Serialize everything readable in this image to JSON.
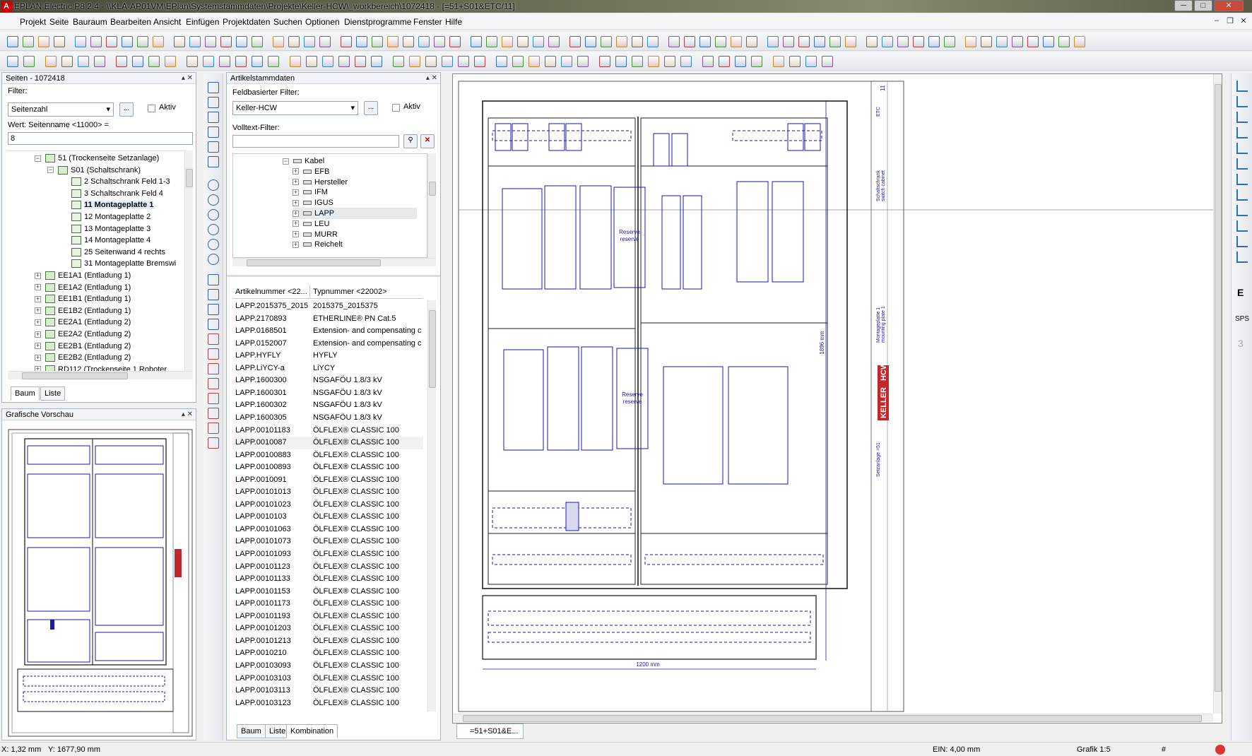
{
  "window": {
    "title": "EPLAN Electric P8 2.4 - \\\\KLA-AP01VM\\EPlan\\Systemstammdaten\\Projekte\\Keller-HCW\\_workbereich\\1072418 - [=51+S01&ETC/11]",
    "logo_text": "A",
    "minimize": "─",
    "maximize": "□",
    "close": "✕"
  },
  "menu": {
    "items": [
      "Projekt",
      "Seite",
      "Bauraum",
      "Bearbeiten",
      "Ansicht",
      "Einfügen",
      "Projektdaten",
      "Suchen",
      "Optionen",
      "Dienstprogramme",
      "Fenster",
      "Hilfe"
    ],
    "mdi_min": "–",
    "mdi_restore": "❐",
    "mdi_close": "✕"
  },
  "pages_panel": {
    "title": "Seiten - 1072418",
    "filter_label": "Filter:",
    "filter_value": "Seitenzahl",
    "filter_button": "...",
    "aktiv_label": "Aktiv",
    "wert_label": "Wert: Seitenname <11000> =",
    "wert_value": "8",
    "tree": [
      {
        "text": "51 (Trockenseite Setzanlage)",
        "level": 0,
        "expander": "⊟",
        "kind": "group"
      },
      {
        "text": "S01 (Schaltschrank)",
        "level": 1,
        "expander": "⊟",
        "kind": "group"
      },
      {
        "text": "2 Schaltschrank Feld 1-3",
        "level": 2,
        "kind": "page"
      },
      {
        "text": "3 Schaltschrank Feld 4",
        "level": 2,
        "kind": "page"
      },
      {
        "text": "11 Montageplatte 1",
        "level": 2,
        "kind": "page",
        "selected": true
      },
      {
        "text": "12 Montageplatte 2",
        "level": 2,
        "kind": "page"
      },
      {
        "text": "13 Montageplatte 3",
        "level": 2,
        "kind": "page"
      },
      {
        "text": "14 Montageplatte 4",
        "level": 2,
        "kind": "page"
      },
      {
        "text": "25 Seitenwand 4 rechts",
        "level": 2,
        "kind": "page"
      },
      {
        "text": "31 Montageplatte Bremswi",
        "level": 2,
        "kind": "page"
      },
      {
        "text": "EE1A1 (Entladung 1)",
        "level": 0,
        "expander": "⊞",
        "kind": "group"
      },
      {
        "text": "EE1A2 (Entladung 1)",
        "level": 0,
        "expander": "⊞",
        "kind": "group"
      },
      {
        "text": "EE1B1 (Entladung 1)",
        "level": 0,
        "expander": "⊞",
        "kind": "group"
      },
      {
        "text": "EE1B2 (Entladung 1)",
        "level": 0,
        "expander": "⊞",
        "kind": "group"
      },
      {
        "text": "EE2A1 (Entladung 2)",
        "level": 0,
        "expander": "⊞",
        "kind": "group"
      },
      {
        "text": "EE2A2 (Entladung 2)",
        "level": 0,
        "expander": "⊞",
        "kind": "group"
      },
      {
        "text": "EE2B1 (Entladung 2)",
        "level": 0,
        "expander": "⊞",
        "kind": "group"
      },
      {
        "text": "EE2B2 (Entladung 2)",
        "level": 0,
        "expander": "⊞",
        "kind": "group"
      },
      {
        "text": "RD112 (Trockenseite 1 Roboter",
        "level": 0,
        "expander": "⊞",
        "kind": "group"
      }
    ],
    "tab_tree": "Baum",
    "tab_list": "Liste"
  },
  "preview_panel": {
    "title": "Grafische Vorschau"
  },
  "parts_panel": {
    "title": "Artikelstammdaten",
    "field_filter_label": "Feldbasierter Filter:",
    "field_filter_value": "Keller-HCW",
    "filter_button": "...",
    "aktiv_label": "Aktiv",
    "fulltext_label": "Volltext-Filter:",
    "fulltext_value": "",
    "tree": [
      {
        "text": "Kabel",
        "expander": "⊟",
        "level": 0
      },
      {
        "text": "EFB",
        "expander": "⊞",
        "level": 1
      },
      {
        "text": "Hersteller",
        "expander": "⊞",
        "level": 1
      },
      {
        "text": "IFM",
        "expander": "⊞",
        "level": 1
      },
      {
        "text": "IGUS",
        "expander": "⊞",
        "level": 1
      },
      {
        "text": "LAPP",
        "expander": "⊞",
        "level": 1,
        "selected": true
      },
      {
        "text": "LEU",
        "expander": "⊞",
        "level": 1
      },
      {
        "text": "MURR",
        "expander": "⊞",
        "level": 1
      },
      {
        "text": "Reichelt",
        "expander": "⊞",
        "level": 1
      }
    ],
    "columns": [
      "Artikelnummer <22...",
      "Typnummer <22002>"
    ],
    "rows": [
      [
        "LAPP.2015375_2015...",
        "2015375_2015375"
      ],
      [
        "LAPP.2170893",
        "ETHERLINE® PN Cat.5"
      ],
      [
        "LAPP.0168501",
        "Extension- and compensating c"
      ],
      [
        "LAPP.0152007",
        "Extension- and compensating c"
      ],
      [
        "LAPP.HYFLY",
        "HYFLY"
      ],
      [
        "LAPP.LiYCY-a",
        "LiYCY"
      ],
      [
        "LAPP.1600300",
        "NSGAFÖU 1.8/3 kV"
      ],
      [
        "LAPP.1600301",
        "NSGAFÖU 1.8/3 kV"
      ],
      [
        "LAPP.1600302",
        "NSGAFÖU 1.8/3 kV"
      ],
      [
        "LAPP.1600305",
        "NSGAFÖU 1.8/3 kV"
      ],
      [
        "LAPP.00101183",
        "ÖLFLEX® CLASSIC 100"
      ],
      [
        "LAPP.0010087",
        "ÖLFLEX® CLASSIC 100"
      ],
      [
        "LAPP.00100883",
        "ÖLFLEX® CLASSIC 100"
      ],
      [
        "LAPP.00100893",
        "ÖLFLEX® CLASSIC 100"
      ],
      [
        "LAPP.0010091",
        "ÖLFLEX® CLASSIC 100"
      ],
      [
        "LAPP.00101013",
        "ÖLFLEX® CLASSIC 100"
      ],
      [
        "LAPP.00101023",
        "ÖLFLEX® CLASSIC 100"
      ],
      [
        "LAPP.0010103",
        "ÖLFLEX® CLASSIC 100"
      ],
      [
        "LAPP.00101063",
        "ÖLFLEX® CLASSIC 100"
      ],
      [
        "LAPP.00101073",
        "ÖLFLEX® CLASSIC 100"
      ],
      [
        "LAPP.00101093",
        "ÖLFLEX® CLASSIC 100"
      ],
      [
        "LAPP.00101123",
        "ÖLFLEX® CLASSIC 100"
      ],
      [
        "LAPP.00101133",
        "ÖLFLEX® CLASSIC 100"
      ],
      [
        "LAPP.00101153",
        "ÖLFLEX® CLASSIC 100"
      ],
      [
        "LAPP.00101173",
        "ÖLFLEX® CLASSIC 100"
      ],
      [
        "LAPP.00101193",
        "ÖLFLEX® CLASSIC 100"
      ],
      [
        "LAPP.00101203",
        "ÖLFLEX® CLASSIC 100"
      ],
      [
        "LAPP.00101213",
        "ÖLFLEX® CLASSIC 100"
      ],
      [
        "LAPP.0010210",
        "ÖLFLEX® CLASSIC 100"
      ],
      [
        "LAPP.00103093",
        "ÖLFLEX® CLASSIC 100"
      ],
      [
        "LAPP.00103103",
        "ÖLFLEX® CLASSIC 100"
      ],
      [
        "LAPP.00103113",
        "ÖLFLEX® CLASSIC 100"
      ],
      [
        "LAPP.00103123",
        "ÖLFLEX® CLASSIC 100"
      ]
    ],
    "tab_tree": "Baum",
    "tab_list": "Liste",
    "tab_combination": "Kombination"
  },
  "drawing": {
    "doc_tab": "=51+S01&E...",
    "dim_width": "1200 mm",
    "dim_height": "1896 mm",
    "reserve_label_1": "Reserve",
    "reserve_label_2": "reserve",
    "logo_keller": "KELLER",
    "logo_hcw": "HCW",
    "title_block_lines": [
      "Montageplatte 1",
      "mounting plate 1",
      "Setzanlage =51",
      "Schaltschrank",
      "switch cabinet",
      "ETC",
      "11"
    ]
  },
  "right_toolbar": {
    "e_label": "E",
    "sps_label": "SPS",
    "num_label": "3"
  },
  "status": {
    "x": "X: 1,32 mm",
    "y": "Y: 1677,90 mm",
    "ein": "EIN: 4,00 mm",
    "grafik": "Grafik 1:5",
    "hash": "#"
  },
  "colors": {
    "drawing_blue": "#1a1aa8",
    "keller_red": "#c0282d",
    "panel_border": "#a9b4c2"
  }
}
